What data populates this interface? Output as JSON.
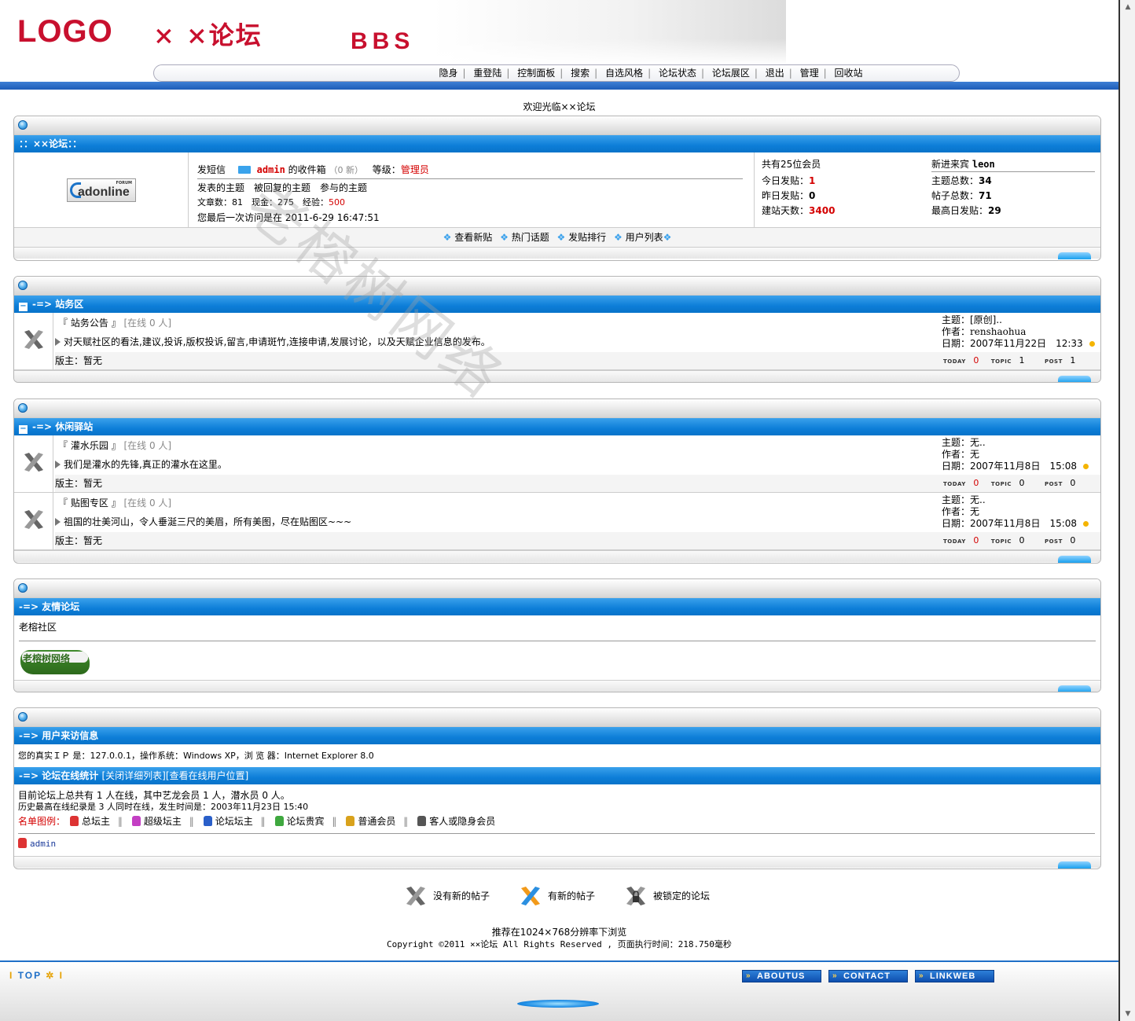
{
  "header": {
    "logo": "LOGO",
    "forum_title": "× ×论坛",
    "bbs": "BBS",
    "nav": [
      "隐身",
      "重登陆",
      "控制面板",
      "搜索",
      "自选风格",
      "论坛状态",
      "论坛展区",
      "退出",
      "管理",
      "回收站"
    ],
    "welcome": "欢迎光临××论坛"
  },
  "user_panel": {
    "title": "：：××论坛：：",
    "logo_text": "adonline",
    "logo_sub": "FORUM",
    "msg_label": "发短信",
    "user": "admin",
    "inbox": "的收件箱",
    "inbox_count": "（0 新）",
    "level_label": "等级：",
    "level": "管理员",
    "links": "发表的主题　被回复的主题　参与的主题",
    "articles": "文章数：81　现金：275　经验：",
    "exp": "500",
    "last_visit": "您最后一次访问是在 2011-6-29 16:47:51",
    "members": "共有25位会员",
    "newest_label": "新进来宾",
    "newest": "leon",
    "today_label": "今日发贴：",
    "today": "1",
    "topics_label": "主题总数：",
    "topics": "34",
    "yesterday_label": "昨日发贴：",
    "yesterday": "0",
    "posts_label": "帖子总数：",
    "posts": "71",
    "days_label": "建站天数：",
    "days": "3400",
    "max_label": "最高日发贴：",
    "max": "29",
    "bottom_links": [
      "查看新贴",
      "热门话题",
      "发贴排行",
      "用户列表"
    ]
  },
  "sections": [
    {
      "title": "-=> 站务区",
      "boards": [
        {
          "name": "『 站务公告 』",
          "online": "[在线 0 人]",
          "desc": "对天赋社区的看法,建议,投诉,版权投诉,留言,申请斑竹,连接申请,发展讨论，以及天赋企业信息的发布。",
          "mod": "版主：暂无",
          "topic": "主题：[原创]..",
          "author": "作者：renshaohua",
          "date": "日期：2007年11月22日　12:33",
          "today": "0",
          "topic_n": "1",
          "post_n": "1"
        }
      ]
    },
    {
      "title": "-=> 休闲驿站",
      "boards": [
        {
          "name": "『 灌水乐园 』",
          "online": "[在线 0 人]",
          "desc": "我们是灌水的先锋,真正的灌水在这里。",
          "mod": "版主：暂无",
          "topic": "主题：无..",
          "author": "作者：无",
          "date": "日期：2007年11月8日　15:08",
          "today": "0",
          "topic_n": "0",
          "post_n": "0"
        },
        {
          "name": "『 贴图专区 』",
          "online": "[在线 0 人]",
          "desc": "祖国的壮美河山，令人垂涎三尺的美眉，所有美图，尽在贴图区~~~",
          "mod": "版主：暂无",
          "topic": "主题：无..",
          "author": "作者：无",
          "date": "日期：2007年11月8日　15:08",
          "today": "0",
          "topic_n": "0",
          "post_n": "0"
        }
      ]
    }
  ],
  "stat_labels": {
    "today": "TODAY",
    "topic": "TOPIC",
    "post": "POST"
  },
  "friends": {
    "title": "-=> 友情论坛",
    "site": "老榕社区",
    "logo_text": "老榕树网络"
  },
  "visitor": {
    "title": "-=> 用户来访信息",
    "info": "您的真实ＩＰ 是：127.0.0.1，操作系统：Windows XP，浏 览 器：Internet Explorer 8.0",
    "online_title": "-=> 论坛在线统计",
    "online_links": "[关闭详细列表][查看在线用户位置]",
    "line1": "目前论坛上总共有 1 人在线，其中艺龙会员 1 人，潜水员 0 人。",
    "line2": "历史最高在线纪录是 3 人同时在线，发生时间是：2003年11月23日 15:40",
    "legend_label": "名单图例：",
    "roles": [
      "总坛主",
      "超级坛主",
      "论坛坛主",
      "论坛贵宾",
      "普通会员",
      "客人或隐身会员"
    ],
    "online_user": "admin"
  },
  "legend": [
    "没有新的帖子",
    "有新的帖子",
    "被锁定的论坛"
  ],
  "footer": {
    "resolution": "推荐在1024×768分辨率下浏览",
    "copyright": "Copyright ©2011 ××论坛 All Rights Reserved , 页面执行时间：218.750毫秒",
    "top": "TOP",
    "buttons": [
      "ABOUTUS",
      "CONTACT",
      "LINKWEB"
    ]
  },
  "watermark": "老榕树网络",
  "colors": {
    "accent_blue": "#0d7ed8",
    "brand_red": "#c8102e",
    "dark_blue_line": "#1d5cb8"
  }
}
